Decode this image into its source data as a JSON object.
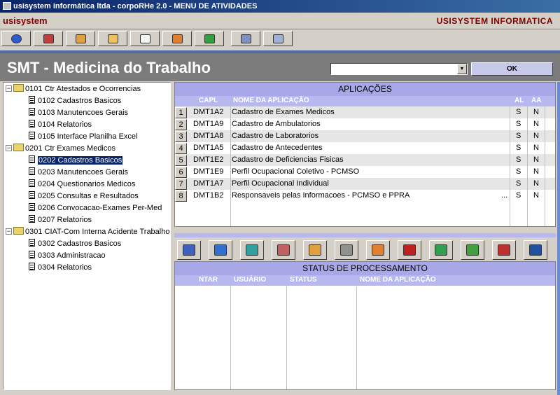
{
  "window": {
    "title": "usisystem informática ltda - corpoRHe 2.0 - MENU DE ATIVIDADES"
  },
  "brand": {
    "left": "usisystem",
    "right": "USISYSTEM INFORMATICA"
  },
  "toolbar": [
    "back-icon",
    "users-icon",
    "hand-icon",
    "exit-icon",
    "checklist-icon",
    "book-icon",
    "green-book-icon",
    "tools-icon",
    "settings-icon"
  ],
  "header": {
    "title": "SMT - Medicina do Trabalho",
    "combo_value": "",
    "ok_label": "OK"
  },
  "tree": [
    {
      "level": 0,
      "type": "folder",
      "label": "0101 Ctr Atestados e Ocorrencias"
    },
    {
      "level": 1,
      "type": "doc",
      "label": "0102 Cadastros Basicos"
    },
    {
      "level": 1,
      "type": "doc",
      "label": "0103 Manutencoes Gerais"
    },
    {
      "level": 1,
      "type": "doc",
      "label": "0104 Relatorios"
    },
    {
      "level": 1,
      "type": "doc",
      "label": "0105 Interface Planilha Excel"
    },
    {
      "level": 0,
      "type": "folder",
      "label": "0201 Ctr Exames Medicos"
    },
    {
      "level": 1,
      "type": "doc",
      "label": "0202 Cadastros Basicos",
      "selected": true
    },
    {
      "level": 1,
      "type": "doc",
      "label": "0203 Manutencoes Gerais"
    },
    {
      "level": 1,
      "type": "doc",
      "label": "0204 Questionarios Medicos"
    },
    {
      "level": 1,
      "type": "doc",
      "label": "0205 Consultas e Resultados"
    },
    {
      "level": 1,
      "type": "doc",
      "label": "0206 Convocacao-Exames Per-Med"
    },
    {
      "level": 1,
      "type": "doc",
      "label": "0207 Relatorios"
    },
    {
      "level": 0,
      "type": "folder",
      "label": "0301 CIAT-Com Interna Acidente Trabalho"
    },
    {
      "level": 1,
      "type": "doc",
      "label": "0302 Cadastros Basicos"
    },
    {
      "level": 1,
      "type": "doc",
      "label": "0303 Administracao"
    },
    {
      "level": 1,
      "type": "doc",
      "label": "0304 Relatorios"
    }
  ],
  "apps": {
    "title": "APLICAÇÕES",
    "columns": {
      "capl": "CAPL",
      "nome": "NOME DA APLICAÇÃO",
      "al": "AL",
      "aa": "AA"
    },
    "rows": [
      {
        "num": "1",
        "capl": "DMT1A2",
        "nome": "Cadastro de Exames Medicos",
        "more": "",
        "al": "S",
        "aa": "N"
      },
      {
        "num": "2",
        "capl": "DMT1A9",
        "nome": "Cadastro de Ambulatorios",
        "more": "",
        "al": "S",
        "aa": "N"
      },
      {
        "num": "3",
        "capl": "DMT1A8",
        "nome": "Cadastro de Laboratorios",
        "more": "",
        "al": "S",
        "aa": "N"
      },
      {
        "num": "4",
        "capl": "DMT1A5",
        "nome": "Cadastro de Antecedentes",
        "more": "",
        "al": "S",
        "aa": "N"
      },
      {
        "num": "5",
        "capl": "DMT1E2",
        "nome": "Cadastro de Deficiencias Fisicas",
        "more": "",
        "al": "S",
        "aa": "N"
      },
      {
        "num": "6",
        "capl": "DMT1E9",
        "nome": "Perfil Ocupacional Coletivo - PCMSO",
        "more": "",
        "al": "S",
        "aa": "N"
      },
      {
        "num": "7",
        "capl": "DMT1A7",
        "nome": "Perfil Ocupacional Individual",
        "more": "",
        "al": "S",
        "aa": "N"
      },
      {
        "num": "8",
        "capl": "DMT1B2",
        "nome": "Responsaveis pelas Informacoes - PCMSO e PPRA",
        "more": "...",
        "al": "S",
        "aa": "N"
      }
    ]
  },
  "action_buttons": [
    "tree-icon",
    "tree-add-icon",
    "recycle-icon",
    "calendar-icon",
    "clock-icon",
    "printer-icon",
    "export-icon",
    "undo-icon",
    "doc-refresh-icon",
    "doc-lightning-icon",
    "redo-icon",
    "word-icon"
  ],
  "status": {
    "title": "STATUS DE PROCESSAMENTO",
    "columns": {
      "ntar": "NTAR",
      "usuario": "USUÁRIO",
      "status": "STATUS",
      "nome": "NOME DA APLICAÇÃO"
    }
  }
}
